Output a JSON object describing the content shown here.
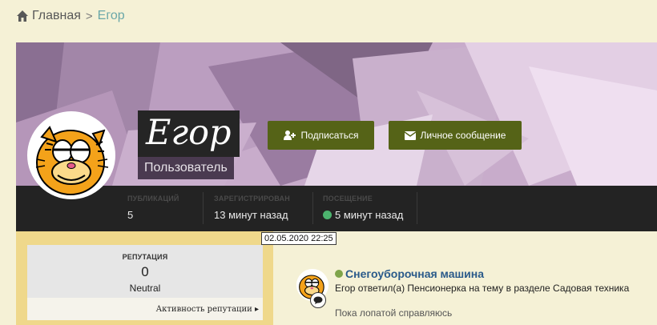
{
  "breadcrumb": {
    "home": "Главная",
    "separator": ">",
    "current": "Егор"
  },
  "profile": {
    "name": "Егор",
    "title": "Пользователь",
    "avatar_icon": "garfield-avatar"
  },
  "actions": {
    "follow_label": "Подписаться",
    "message_label": "Личное сообщение",
    "accent_color": "#556317"
  },
  "stats": [
    {
      "label": "ПУБЛИКАЦИЙ",
      "value": "5"
    },
    {
      "label": "ЗАРЕГИСТРИРОВАН",
      "value": "13 минут назад"
    },
    {
      "label": "ПОСЕЩЕНИЕ",
      "value": "5 минут назад"
    }
  ],
  "tooltip": "02.05.2020 22:25",
  "reputation": {
    "title": "РЕПУТАЦИЯ",
    "value": "0",
    "label": "Neutral",
    "activity_link": "Активность репутации ▸"
  },
  "feed": {
    "title": "Снегоуборочная машина",
    "text": "Егор ответил(а) Пенсионерка на тему в разделе Садовая техника",
    "snippet": "Пока лопатой справляюсь"
  }
}
